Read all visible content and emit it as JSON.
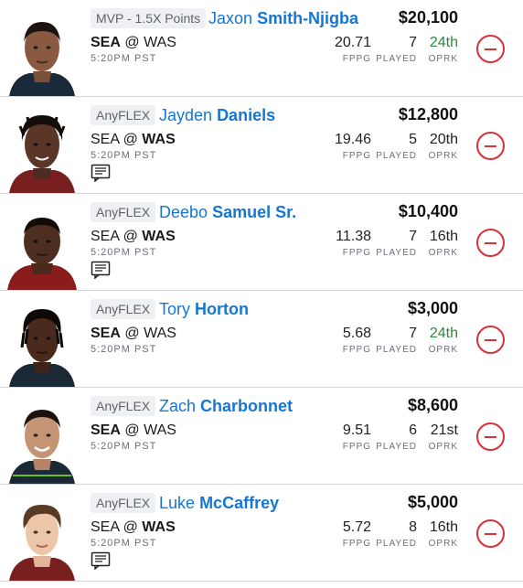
{
  "players": [
    {
      "slot": "MVP - 1.5X Points",
      "first": "Jaxon",
      "last": "Smith-Njigba",
      "team": "SEA",
      "at": "@",
      "opp": "WAS",
      "time": "5:20PM PST",
      "salary": "$20,100",
      "fppg": "20.71",
      "played": "7",
      "oprk": "24th",
      "labels": {
        "fppg": "FPPG",
        "played": "PLAYED",
        "oprk": "OPRK"
      },
      "has_note": false,
      "jersey_color": "#1a2a3a"
    },
    {
      "slot": "AnyFLEX",
      "first": "Jayden",
      "last": "Daniels",
      "team": "SEA",
      "at": "@",
      "opp": "WAS",
      "time": "5:20PM PST",
      "salary": "$12,800",
      "fppg": "19.46",
      "played": "5",
      "oprk": "20th",
      "labels": {
        "fppg": "FPPG",
        "played": "PLAYED",
        "oprk": "OPRK"
      },
      "has_note": true,
      "jersey_color": "#7a1f1f"
    },
    {
      "slot": "AnyFLEX",
      "first": "Deebo",
      "last": "Samuel Sr.",
      "team": "SEA",
      "at": "@",
      "opp": "WAS",
      "time": "5:20PM PST",
      "salary": "$10,400",
      "fppg": "11.38",
      "played": "7",
      "oprk": "16th",
      "labels": {
        "fppg": "FPPG",
        "played": "PLAYED",
        "oprk": "OPRK"
      },
      "has_note": true,
      "jersey_color": "#8a1c1c"
    },
    {
      "slot": "AnyFLEX",
      "first": "Tory",
      "last": "Horton",
      "team": "SEA",
      "at": "@",
      "opp": "WAS",
      "time": "5:20PM PST",
      "salary": "$3,000",
      "fppg": "5.68",
      "played": "7",
      "oprk": "24th",
      "labels": {
        "fppg": "FPPG",
        "played": "PLAYED",
        "oprk": "OPRK"
      },
      "has_note": false,
      "jersey_color": "#1b2836"
    },
    {
      "slot": "AnyFLEX",
      "first": "Zach",
      "last": "Charbonnet",
      "team": "SEA",
      "at": "@",
      "opp": "WAS",
      "time": "5:20PM PST",
      "salary": "$8,600",
      "fppg": "9.51",
      "played": "6",
      "oprk": "21st",
      "labels": {
        "fppg": "FPPG",
        "played": "PLAYED",
        "oprk": "OPRK"
      },
      "has_note": false,
      "jersey_color": "#1b2836"
    },
    {
      "slot": "AnyFLEX",
      "first": "Luke",
      "last": "McCaffrey",
      "team": "SEA",
      "at": "@",
      "opp": "WAS",
      "time": "5:20PM PST",
      "salary": "$5,000",
      "fppg": "5.72",
      "played": "8",
      "oprk": "16th",
      "labels": {
        "fppg": "FPPG",
        "played": "PLAYED",
        "oprk": "OPRK"
      },
      "has_note": true,
      "jersey_color": "#7a1f1f"
    }
  ],
  "colors": {
    "name_blue": "#1676d2",
    "remove_red": "#d3343a",
    "rank_green": "#2e8540",
    "slot_bg": "#eef0f3"
  },
  "icons": {
    "remove": "minus-circle-icon",
    "note": "news-note-icon"
  }
}
